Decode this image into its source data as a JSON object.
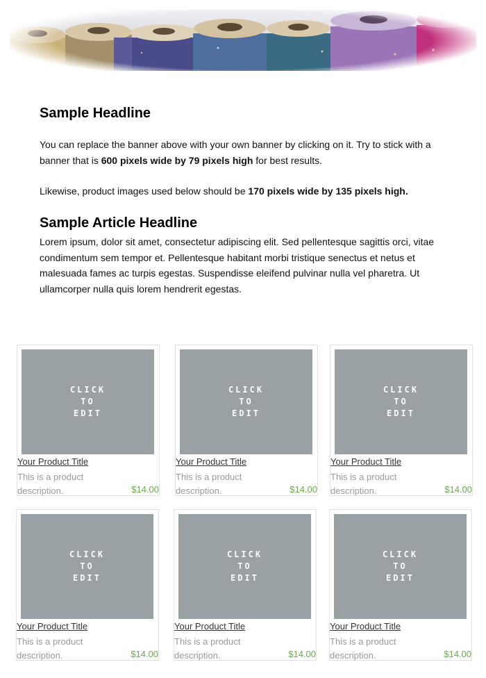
{
  "banner": {
    "alt": "Thread spools banner"
  },
  "headline": "Sample Headline",
  "intro1": {
    "part1": "You can replace the banner above with your own banner by clicking on it.  Try to stick with a banner that is ",
    "bold": "600 pixels wide by 79 pixels high",
    "part2": " for best results."
  },
  "intro2": {
    "part1": "Likewise, product images used below should be ",
    "bold": "170 pixels wide by 135 pixels high."
  },
  "article": {
    "headline": "Sample Article Headline",
    "body": "Lorem ipsum, dolor sit amet, consectetur adipiscing elit. Sed pellentesque sagittis orci, vitae condimentum sem tempor et. Pellentesque habitant morbi tristique senectus et netus et malesuada fames ac turpis egestas. Suspendisse eleifend pulvinar nulla vel pharetra. Ut ullamcorper nulla quis lorem hendrerit egestas."
  },
  "products": [
    {
      "image_text": "CLICK\nTO\nEDIT",
      "title": "Your Product Title",
      "description": "This is a product description.",
      "price": "$14.00"
    },
    {
      "image_text": "CLICK\nTO\nEDIT",
      "title": "Your Product Title",
      "description": "This is a product description.",
      "price": "$14.00"
    },
    {
      "image_text": "CLICK\nTO\nEDIT",
      "title": "Your Product Title",
      "description": "This is a product description.",
      "price": "$14.00"
    },
    {
      "image_text": "CLICK\nTO\nEDIT",
      "title": "Your Product Title",
      "description": "This is a product description.",
      "price": "$14.00"
    },
    {
      "image_text": "CLICK\nTO\nEDIT",
      "title": "Your Product Title",
      "description": "This is a product description.",
      "price": "$14.00"
    },
    {
      "image_text": "CLICK\nTO\nEDIT",
      "title": "Your Product Title",
      "description": "This is a product description.",
      "price": "$14.00"
    }
  ],
  "colors": {
    "placeholder": "#9aa1a4",
    "price": "#6aa84f",
    "description": "#9a9a9a"
  }
}
